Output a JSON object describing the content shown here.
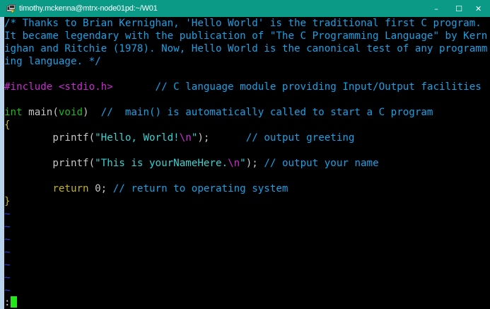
{
  "window": {
    "title": "timothy.mckenna@mtrx-node01pd:~/W01",
    "minimize_label": "–",
    "maximize_label": "☐",
    "close_label": "✕"
  },
  "colors": {
    "titlebar": "#0b9a86",
    "comment": "#17a2e6",
    "preprocessor": "#c92bd0",
    "type": "#1eb81e",
    "string": "#36d3d3",
    "keyword": "#c4b51b",
    "tilde": "#2b3fd8",
    "cursor": "#22e81a"
  },
  "editor": {
    "header_comment": [
      "/* Thanks to Brian Kernighan, 'Hello World' is the traditional first C program.",
      "It became legendary with the publication of \"The C Programming Language\" by Kern",
      "ighan and Ritchie (1978). Now, Hello World is the canonical test of any programm",
      "ing language. */"
    ],
    "include_directive": "#include <stdio.h>",
    "include_gap": "       ",
    "include_comment": "// C language module providing Input/Output facilities",
    "main_type": "int",
    "main_name": " main(",
    "main_param": "void",
    "main_close": ")  ",
    "main_comment": "//  main() is automatically called to start a C program",
    "open_brace": "{",
    "printf1_indent": "        ",
    "printf1_fn": "printf(",
    "printf1_str": "\"Hello, World!",
    "printf1_esc": "\\n",
    "printf1_strend": "\"",
    "printf1_end": ");",
    "printf1_gap": "      ",
    "printf1_comment": "// output greeting",
    "printf2_indent": "        ",
    "printf2_fn": "printf(",
    "printf2_str": "\"This is yourNameHere.",
    "printf2_esc": "\\n",
    "printf2_strend": "\"",
    "printf2_end": "); ",
    "printf2_comment": "// output your name",
    "return_indent": "        ",
    "return_kw": "return",
    "return_val": " 0; ",
    "return_comment": "// return to operating system",
    "close_brace": "}",
    "tilde": "~",
    "command_prompt": ":"
  }
}
